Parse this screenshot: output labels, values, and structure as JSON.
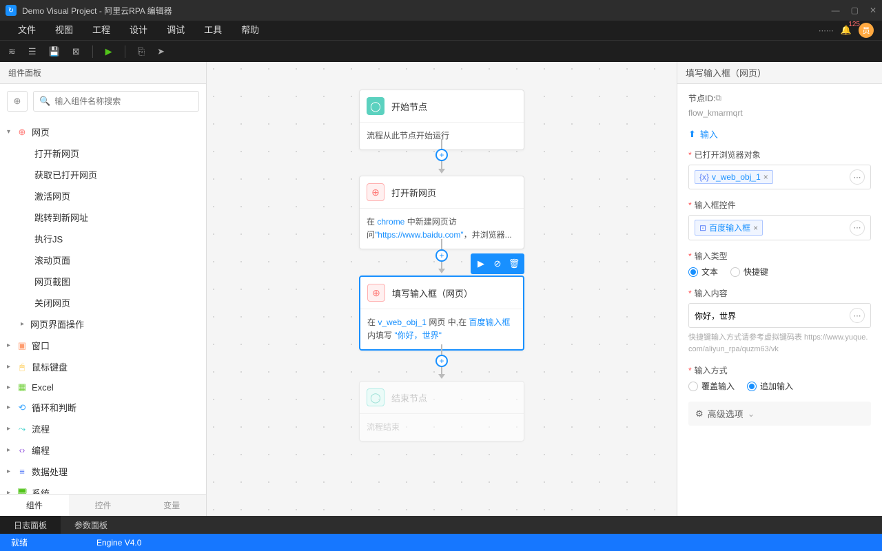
{
  "title": "Demo Visual Project - 阿里云RPA 编辑器",
  "menu": [
    "文件",
    "视图",
    "工程",
    "设计",
    "调试",
    "工具",
    "帮助"
  ],
  "notif_count": "125",
  "avatar": "员",
  "left_panel_title": "组件面板",
  "search_placeholder": "输入组件名称搜索",
  "tree": {
    "web": "网页",
    "web_children": [
      "打开新网页",
      "获取已打开网页",
      "激活网页",
      "跳转到新网址",
      "执行JS",
      "滚动页面",
      "网页截图",
      "关闭网页",
      "网页界面操作"
    ],
    "window": "窗口",
    "mouse": "鼠标键盘",
    "excel": "Excel",
    "loop": "循环和判断",
    "flow": "流程",
    "code": "编程",
    "data": "数据处理",
    "system": "系统"
  },
  "left_tabs": [
    "组件",
    "控件",
    "变量"
  ],
  "nodes": {
    "start": {
      "title": "开始节点",
      "desc": "流程从此节点开始运行"
    },
    "open": {
      "title": "打开新网页",
      "desc_pre": "在 ",
      "chrome": "chrome",
      "desc_mid": " 中新建网页访问",
      "url": "\"https://www.baidu.com\"",
      "desc_post": "，并浏览器..."
    },
    "fill": {
      "title": "填写输入框（网页）",
      "pre": "在 ",
      "obj": "v_web_obj_1",
      "mid1": " 网页 中,在 ",
      "ctrl": "百度输入框",
      "mid2": " 内填写 ",
      "val": "\"你好，世界\""
    },
    "end": {
      "title": "结束节点",
      "desc": "流程结束"
    }
  },
  "right": {
    "title": "填写输入框（网页）",
    "node_id_label": "节点ID:",
    "node_id": "flow_kmarmqrt",
    "input_section": "输入",
    "browser_obj_label": "已打开浏览器对象",
    "browser_obj_val": "v_web_obj_1",
    "input_ctrl_label": "输入框控件",
    "input_ctrl_val": "百度输入框",
    "input_type_label": "输入类型",
    "type_text": "文本",
    "type_shortcut": "快捷键",
    "input_content_label": "输入内容",
    "input_content_val": "你好，世界",
    "helper": "快捷键输入方式请参考虚拟键码表 https://www.yuque.com/aliyun_rpa/quzm63/vk",
    "input_mode_label": "输入方式",
    "mode_override": "覆盖输入",
    "mode_append": "追加输入",
    "advanced": "高级选项"
  },
  "bottom_tabs": [
    "日志面板",
    "参数面板"
  ],
  "status": {
    "ready": "就绪",
    "engine": "Engine V4.0"
  }
}
